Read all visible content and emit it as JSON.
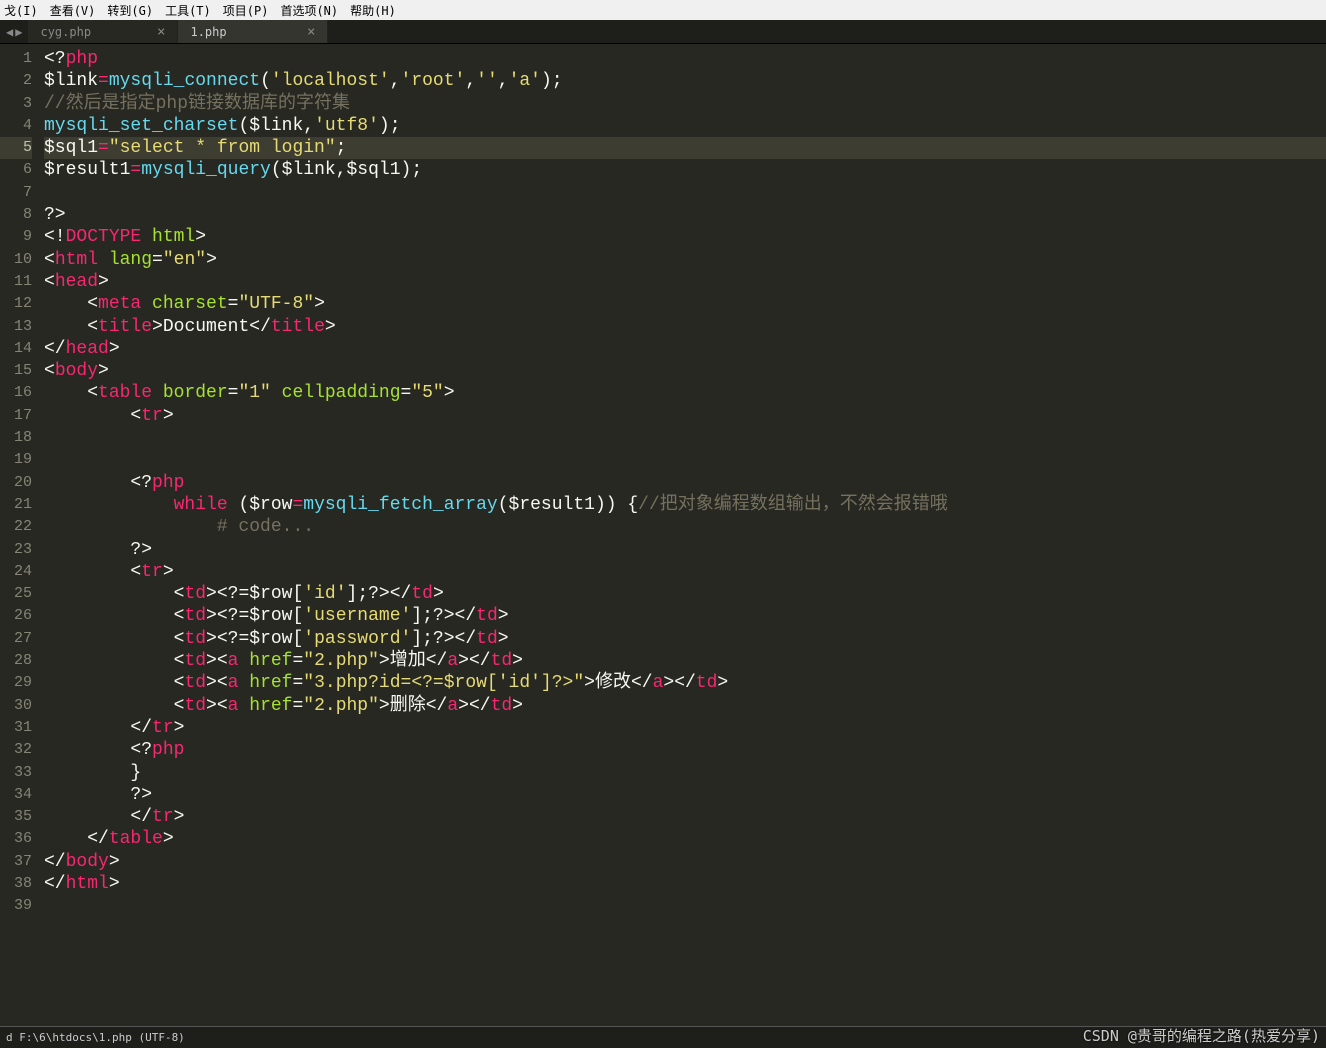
{
  "menu": [
    "戈(I)",
    "查看(V)",
    "转到(G)",
    "工具(T)",
    "项目(P)",
    "首选项(N)",
    "帮助(H)"
  ],
  "tabs": [
    {
      "name": "cyg.php",
      "active": false
    },
    {
      "name": "1.php",
      "active": true
    }
  ],
  "nav": {
    "prev": "◀",
    "next": "▶"
  },
  "current_line": 5,
  "lines": [
    {
      "n": 1,
      "segs": [
        [
          "punc",
          "<?"
        ],
        [
          "tag",
          "php"
        ]
      ]
    },
    {
      "n": 2,
      "segs": [
        [
          "var",
          "$link"
        ],
        [
          "op",
          "="
        ],
        [
          "fn",
          "mysqli_connect"
        ],
        [
          "punc",
          "("
        ],
        [
          "str",
          "'localhost'"
        ],
        [
          "punc",
          ","
        ],
        [
          "str",
          "'root'"
        ],
        [
          "punc",
          ","
        ],
        [
          "str",
          "''"
        ],
        [
          "punc",
          ","
        ],
        [
          "str",
          "'a'"
        ],
        [
          "punc",
          ");"
        ]
      ]
    },
    {
      "n": 3,
      "segs": [
        [
          "cm",
          "//然后是指定php链接数据库的字符集"
        ]
      ]
    },
    {
      "n": 4,
      "segs": [
        [
          "fn",
          "mysqli_set_charset"
        ],
        [
          "punc",
          "("
        ],
        [
          "var",
          "$link"
        ],
        [
          "punc",
          ","
        ],
        [
          "str",
          "'utf8'"
        ],
        [
          "punc",
          ");"
        ]
      ]
    },
    {
      "n": 5,
      "segs": [
        [
          "var",
          "$sql1"
        ],
        [
          "op",
          "="
        ],
        [
          "str",
          "\"select * from login\""
        ],
        [
          "punc",
          ";"
        ]
      ]
    },
    {
      "n": 6,
      "segs": [
        [
          "var",
          "$result1"
        ],
        [
          "op",
          "="
        ],
        [
          "fn",
          "mysqli_query"
        ],
        [
          "punc",
          "("
        ],
        [
          "var",
          "$link"
        ],
        [
          "punc",
          ","
        ],
        [
          "var",
          "$sql1"
        ],
        [
          "punc",
          ");"
        ]
      ]
    },
    {
      "n": 7,
      "segs": []
    },
    {
      "n": 8,
      "segs": [
        [
          "punc",
          "?>"
        ]
      ]
    },
    {
      "n": 9,
      "segs": [
        [
          "punc",
          "<!"
        ],
        [
          "tag",
          "DOCTYPE "
        ],
        [
          "attr",
          "html"
        ],
        [
          "punc",
          ">"
        ]
      ]
    },
    {
      "n": 10,
      "segs": [
        [
          "punc",
          "<"
        ],
        [
          "tag",
          "html "
        ],
        [
          "attr",
          "lang"
        ],
        [
          "punc",
          "="
        ],
        [
          "str",
          "\"en\""
        ],
        [
          "punc",
          ">"
        ]
      ]
    },
    {
      "n": 11,
      "segs": [
        [
          "punc",
          "<"
        ],
        [
          "tag",
          "head"
        ],
        [
          "punc",
          ">"
        ]
      ]
    },
    {
      "n": 12,
      "segs": [
        [
          "punc",
          "    <"
        ],
        [
          "tag",
          "meta "
        ],
        [
          "attr",
          "charset"
        ],
        [
          "punc",
          "="
        ],
        [
          "str",
          "\"UTF-8\""
        ],
        [
          "punc",
          ">"
        ]
      ]
    },
    {
      "n": 13,
      "segs": [
        [
          "punc",
          "    <"
        ],
        [
          "tag",
          "title"
        ],
        [
          "punc",
          ">"
        ],
        [
          "white",
          "Document"
        ],
        [
          "punc",
          "</"
        ],
        [
          "tag",
          "title"
        ],
        [
          "punc",
          ">"
        ]
      ]
    },
    {
      "n": 14,
      "segs": [
        [
          "punc",
          "</"
        ],
        [
          "tag",
          "head"
        ],
        [
          "punc",
          ">"
        ]
      ]
    },
    {
      "n": 15,
      "segs": [
        [
          "punc",
          "<"
        ],
        [
          "tag",
          "body"
        ],
        [
          "punc",
          ">"
        ]
      ]
    },
    {
      "n": 16,
      "segs": [
        [
          "punc",
          "    <"
        ],
        [
          "tag",
          "table "
        ],
        [
          "attr",
          "border"
        ],
        [
          "punc",
          "="
        ],
        [
          "str",
          "\"1\""
        ],
        [
          "punc",
          " "
        ],
        [
          "attr",
          "cellpadding"
        ],
        [
          "punc",
          "="
        ],
        [
          "str",
          "\"5\""
        ],
        [
          "punc",
          ">"
        ]
      ]
    },
    {
      "n": 17,
      "segs": [
        [
          "punc",
          "        <"
        ],
        [
          "tag",
          "tr"
        ],
        [
          "punc",
          ">"
        ]
      ]
    },
    {
      "n": 18,
      "segs": []
    },
    {
      "n": 19,
      "segs": []
    },
    {
      "n": 20,
      "segs": [
        [
          "punc",
          "        <?"
        ],
        [
          "tag",
          "php"
        ]
      ]
    },
    {
      "n": 21,
      "segs": [
        [
          "punc",
          "            "
        ],
        [
          "kw",
          "while"
        ],
        [
          "punc",
          " ("
        ],
        [
          "var",
          "$row"
        ],
        [
          "op",
          "="
        ],
        [
          "fn",
          "mysqli_fetch_array"
        ],
        [
          "punc",
          "("
        ],
        [
          "var",
          "$result1"
        ],
        [
          "punc",
          ")) {"
        ],
        [
          "cm",
          "//把对象编程数组输出，不然会报错哦"
        ]
      ]
    },
    {
      "n": 22,
      "segs": [
        [
          "punc",
          "                "
        ],
        [
          "cm",
          "# code..."
        ]
      ]
    },
    {
      "n": 23,
      "segs": [
        [
          "punc",
          "        ?>"
        ]
      ]
    },
    {
      "n": 24,
      "segs": [
        [
          "punc",
          "        <"
        ],
        [
          "tag",
          "tr"
        ],
        [
          "punc",
          ">"
        ]
      ]
    },
    {
      "n": 25,
      "segs": [
        [
          "punc",
          "            <"
        ],
        [
          "tag",
          "td"
        ],
        [
          "punc",
          "><?="
        ],
        [
          "var",
          "$row"
        ],
        [
          "punc",
          "["
        ],
        [
          "str",
          "'id'"
        ],
        [
          "punc",
          "];?></"
        ],
        [
          "tag",
          "td"
        ],
        [
          "punc",
          ">"
        ]
      ]
    },
    {
      "n": 26,
      "segs": [
        [
          "punc",
          "            <"
        ],
        [
          "tag",
          "td"
        ],
        [
          "punc",
          "><?="
        ],
        [
          "var",
          "$row"
        ],
        [
          "punc",
          "["
        ],
        [
          "str",
          "'username'"
        ],
        [
          "punc",
          "];?></"
        ],
        [
          "tag",
          "td"
        ],
        [
          "punc",
          ">"
        ]
      ]
    },
    {
      "n": 27,
      "segs": [
        [
          "punc",
          "            <"
        ],
        [
          "tag",
          "td"
        ],
        [
          "punc",
          "><?="
        ],
        [
          "var",
          "$row"
        ],
        [
          "punc",
          "["
        ],
        [
          "str",
          "'password'"
        ],
        [
          "punc",
          "];?></"
        ],
        [
          "tag",
          "td"
        ],
        [
          "punc",
          ">"
        ]
      ]
    },
    {
      "n": 28,
      "segs": [
        [
          "punc",
          "            <"
        ],
        [
          "tag",
          "td"
        ],
        [
          "punc",
          "><"
        ],
        [
          "tag",
          "a "
        ],
        [
          "attr",
          "href"
        ],
        [
          "punc",
          "="
        ],
        [
          "str",
          "\"2.php\""
        ],
        [
          "punc",
          ">"
        ],
        [
          "white",
          "增加"
        ],
        [
          "punc",
          "</"
        ],
        [
          "tag",
          "a"
        ],
        [
          "punc",
          "></"
        ],
        [
          "tag",
          "td"
        ],
        [
          "punc",
          ">"
        ]
      ]
    },
    {
      "n": 29,
      "segs": [
        [
          "punc",
          "            <"
        ],
        [
          "tag",
          "td"
        ],
        [
          "punc",
          "><"
        ],
        [
          "tag",
          "a "
        ],
        [
          "attr",
          "href"
        ],
        [
          "punc",
          "="
        ],
        [
          "str",
          "\"3.php?id=<?=$row['id']?>\""
        ],
        [
          "punc",
          ">"
        ],
        [
          "white",
          "修改"
        ],
        [
          "punc",
          "</"
        ],
        [
          "tag",
          "a"
        ],
        [
          "punc",
          "></"
        ],
        [
          "tag",
          "td"
        ],
        [
          "punc",
          ">"
        ]
      ]
    },
    {
      "n": 30,
      "segs": [
        [
          "punc",
          "            <"
        ],
        [
          "tag",
          "td"
        ],
        [
          "punc",
          "><"
        ],
        [
          "tag",
          "a "
        ],
        [
          "attr",
          "href"
        ],
        [
          "punc",
          "="
        ],
        [
          "str",
          "\"2.php\""
        ],
        [
          "punc",
          ">"
        ],
        [
          "white",
          "删除"
        ],
        [
          "punc",
          "</"
        ],
        [
          "tag",
          "a"
        ],
        [
          "punc",
          "></"
        ],
        [
          "tag",
          "td"
        ],
        [
          "punc",
          ">"
        ]
      ]
    },
    {
      "n": 31,
      "segs": [
        [
          "punc",
          "        </"
        ],
        [
          "tag",
          "tr"
        ],
        [
          "punc",
          ">"
        ]
      ]
    },
    {
      "n": 32,
      "segs": [
        [
          "punc",
          "        <?"
        ],
        [
          "tag",
          "php"
        ]
      ]
    },
    {
      "n": 33,
      "segs": [
        [
          "punc",
          "        }"
        ]
      ]
    },
    {
      "n": 34,
      "segs": [
        [
          "punc",
          "        ?>"
        ]
      ]
    },
    {
      "n": 35,
      "segs": [
        [
          "punc",
          "        </"
        ],
        [
          "tag",
          "tr"
        ],
        [
          "punc",
          ">"
        ]
      ]
    },
    {
      "n": 36,
      "segs": [
        [
          "punc",
          "    </"
        ],
        [
          "tag",
          "table"
        ],
        [
          "punc",
          ">"
        ]
      ]
    },
    {
      "n": 37,
      "segs": [
        [
          "punc",
          "</"
        ],
        [
          "tag",
          "body"
        ],
        [
          "punc",
          ">"
        ]
      ]
    },
    {
      "n": 38,
      "segs": [
        [
          "punc",
          "</"
        ],
        [
          "tag",
          "html"
        ],
        [
          "punc",
          ">"
        ]
      ]
    },
    {
      "n": 39,
      "segs": []
    }
  ],
  "status": {
    "left": "d F:\\6\\htdocs\\1.php (UTF-8)"
  },
  "watermark": "CSDN @贵哥的编程之路(热爱分享)"
}
